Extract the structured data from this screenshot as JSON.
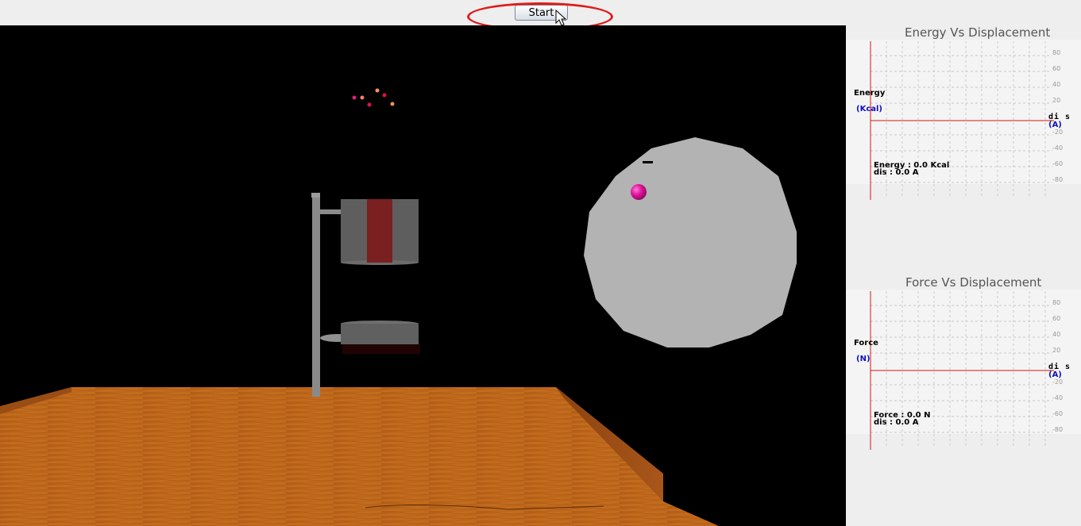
{
  "toolbar": {
    "start_label": "Start"
  },
  "colors": {
    "highlight": "#e01b1b",
    "axis": "#d01818",
    "unit": "#1010c0",
    "table": "#b8631a",
    "ball": "#e0129a"
  },
  "energy_graph": {
    "title": "Energy Vs Displacement",
    "y_label": "Energy",
    "y_unit": "(Kcal)",
    "x_label": "di s",
    "x_unit": "(A)",
    "ticks": [
      "80",
      "60",
      "40",
      "20",
      "-20",
      "-40",
      "-60",
      "-80"
    ],
    "reading_value": "Energy : 0.0 Kcal",
    "reading_dis": "dis : 0.0 A"
  },
  "force_graph": {
    "title": "Force Vs Displacement",
    "y_label": "Force",
    "y_unit": "(N)",
    "x_label": "di s",
    "x_unit": "(A)",
    "ticks": [
      "80",
      "60",
      "40",
      "20",
      "-20",
      "-40",
      "-60",
      "-80"
    ],
    "reading_value": "Force : 0.0 N",
    "reading_dis": "dis : 0.0 A"
  }
}
